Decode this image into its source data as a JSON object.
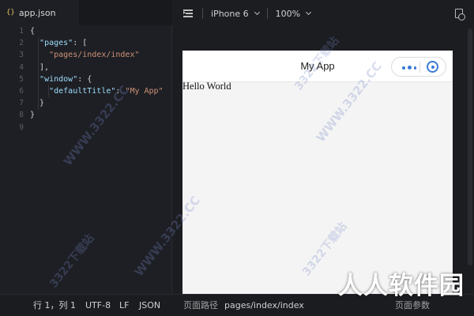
{
  "editor": {
    "tab": {
      "icon": "{}",
      "label": "app.json"
    },
    "line_numbers": [
      "1",
      "2",
      "3",
      "4",
      "5",
      "6",
      "7",
      "8",
      "9"
    ],
    "code": [
      [
        {
          "t": "{",
          "c": "p"
        }
      ],
      [
        {
          "t": "  ",
          "c": "p"
        },
        {
          "t": "\"pages\"",
          "c": "k"
        },
        {
          "t": ": [",
          "c": "p"
        }
      ],
      [
        {
          "t": "    ",
          "c": "p"
        },
        {
          "t": "\"pages/index/index\"",
          "c": "s"
        }
      ],
      [
        {
          "t": "  ],",
          "c": "p"
        }
      ],
      [
        {
          "t": "  ",
          "c": "p"
        },
        {
          "t": "\"window\"",
          "c": "k"
        },
        {
          "t": ": {",
          "c": "p"
        }
      ],
      [
        {
          "t": "    ",
          "c": "p"
        },
        {
          "t": "\"defaultTitle\"",
          "c": "k"
        },
        {
          "t": ": ",
          "c": "p"
        },
        {
          "t": "\"My App\"",
          "c": "s"
        }
      ],
      [
        {
          "t": "  }",
          "c": "p"
        }
      ],
      [
        {
          "t": "}",
          "c": "p"
        }
      ],
      [
        {
          "t": "",
          "c": "p"
        }
      ]
    ]
  },
  "simulator": {
    "toolbar": {
      "menu_icon": "list-indent-icon",
      "device": "iPhone 6",
      "zoom": "100%",
      "right_icon": "document-search-icon"
    },
    "phone": {
      "nav_title": "My App",
      "content_text": "Hello World"
    }
  },
  "status_bar": {
    "position": "行 1，列 1",
    "encoding": "UTF-8",
    "line_ending": "LF",
    "language": "JSON",
    "page_path_label": "页面路径",
    "page_path": "pages/index/index",
    "page_params": "页面参数"
  },
  "watermark": {
    "site": "WWW.3322.CC",
    "brand": "3322下载站",
    "big_text": "人人软件园"
  }
}
